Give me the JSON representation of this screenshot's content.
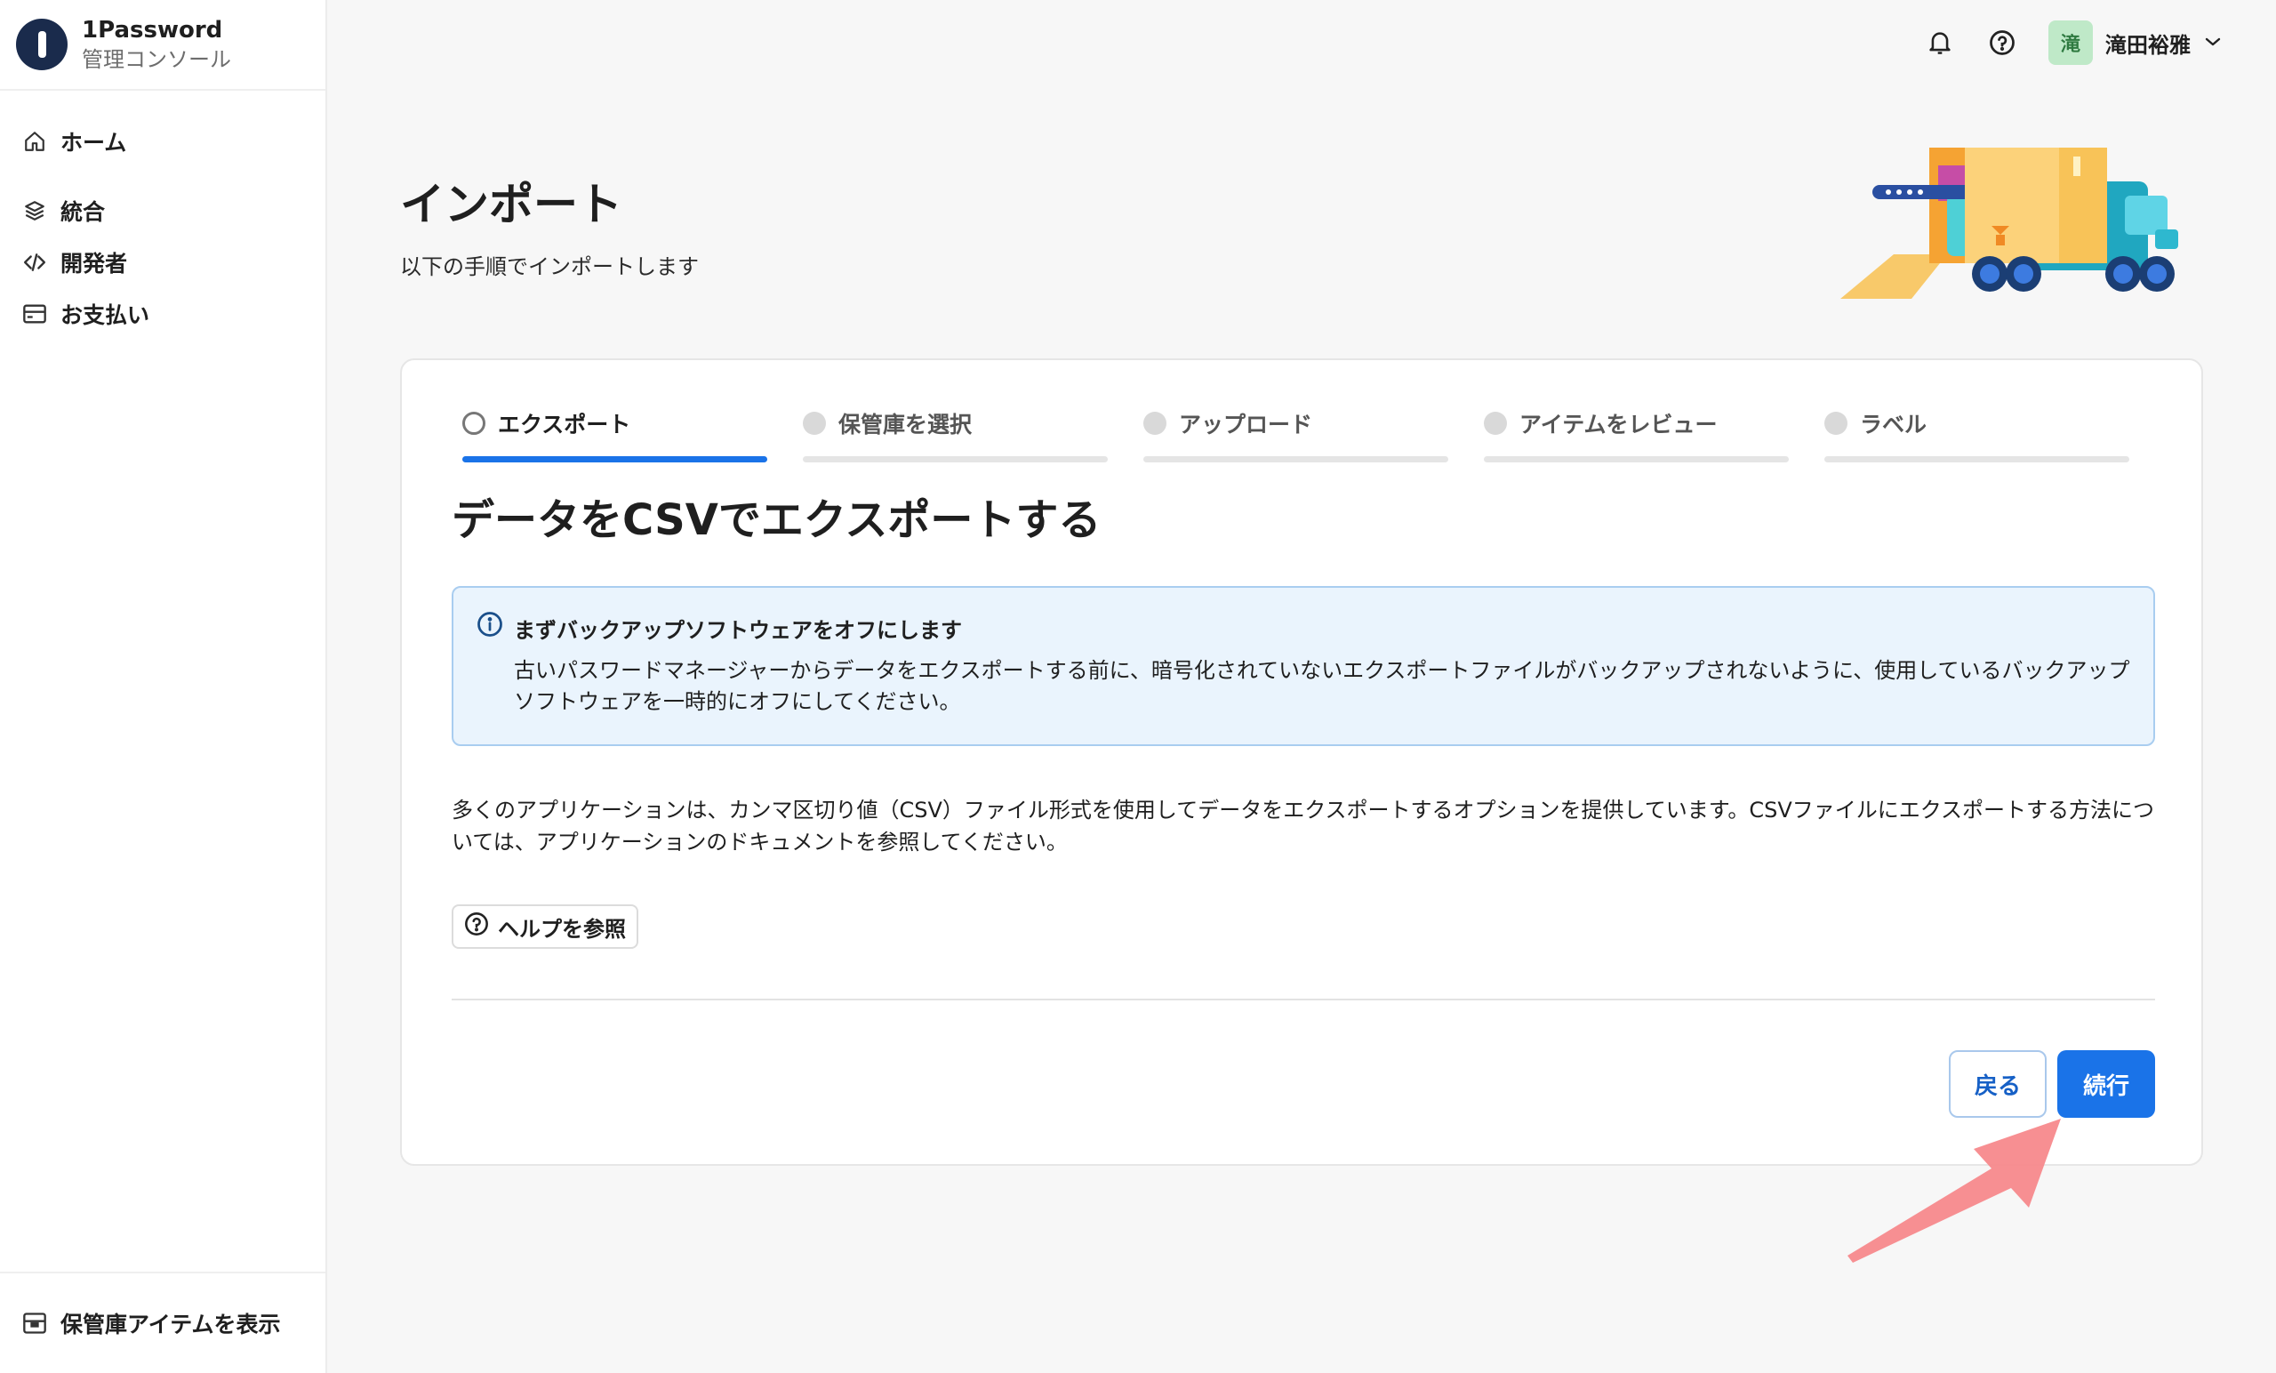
{
  "brand": {
    "name": "1Password",
    "subtitle": "管理コンソール"
  },
  "sidebar": {
    "items": [
      {
        "label": "ホーム",
        "icon": "home-icon"
      },
      {
        "label": "統合",
        "icon": "integrations-icon"
      },
      {
        "label": "開発者",
        "icon": "code-icon"
      },
      {
        "label": "お支払い",
        "icon": "credit-card-icon"
      }
    ],
    "footer": {
      "label": "保管庫アイテムを表示",
      "icon": "vault-icon"
    }
  },
  "topbar": {
    "user": {
      "initial": "滝",
      "name": "滝田裕雅"
    }
  },
  "page": {
    "title": "インポート",
    "subtitle": "以下の手順でインポートします"
  },
  "steps": [
    {
      "label": "エクスポート",
      "active": true
    },
    {
      "label": "保管庫を選択",
      "active": false
    },
    {
      "label": "アップロード",
      "active": false
    },
    {
      "label": "アイテムをレビュー",
      "active": false
    },
    {
      "label": "ラベル",
      "active": false
    }
  ],
  "content": {
    "section_title": "データをCSVでエクスポートする",
    "info": {
      "title": "まずバックアップソフトウェアをオフにします",
      "body": "古いパスワードマネージャーからデータをエクスポートする前に、暗号化されていないエクスポートファイルがバックアップされないように、使用しているバックアップソフトウェアを一時的にオフにしてください。"
    },
    "description": "多くのアプリケーションは、カンマ区切り値（CSV）ファイル形式を使用してデータをエクスポートするオプションを提供しています。CSVファイルにエクスポートする方法については、アプリケーションのドキュメントを参照してください。",
    "help_label": "ヘルプを参照",
    "back_label": "戻る",
    "continue_label": "続行"
  },
  "colors": {
    "accent": "#1a73e8",
    "info_bg": "#eaf4fd",
    "annotation_arrow": "#f7898c"
  }
}
